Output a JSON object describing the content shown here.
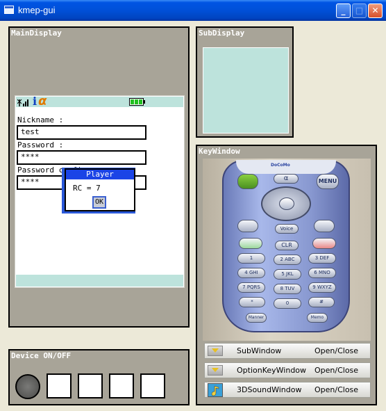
{
  "window": {
    "title": "kmep-gui",
    "minimize": "_",
    "maximize": "□",
    "close": "✕"
  },
  "main_display": {
    "title": "MainDisplay",
    "status_alpha": "α",
    "status_info": "i",
    "nickname_label": "Nickname :",
    "nickname_value": "test",
    "password_label": "Password :",
    "password_value": "****",
    "password_confirm_label": "Password confirm:",
    "password_confirm_value": "****",
    "dialog": {
      "title": "Player",
      "message": "RC = 7",
      "ok": "OK"
    }
  },
  "sub_display": {
    "title": "SubDisplay"
  },
  "key_window": {
    "title": "KeyWindow",
    "brand": "DoCoMo",
    "keys": {
      "alpha": "α",
      "menu": "MENU",
      "voice": "Voice",
      "clr": "CLR",
      "k1": "1",
      "k2": "2 ABC",
      "k3": "3 DEF",
      "k4": "4 GHI",
      "k5": "5 JKL",
      "k6": "6 MNO",
      "k7": "7 PQRS",
      "k8": "8 TUV",
      "k9": "9 WXYZ",
      "kstar": "*",
      "k0": "0",
      "khash": "#",
      "manner": "Manner",
      "memo": "Memo"
    },
    "rows": [
      {
        "name": "SubWindow",
        "action": "Open/Close",
        "icon": "toggle-icon"
      },
      {
        "name": "OptionKeyWindow",
        "action": "Open/Close",
        "icon": "toggle-icon"
      },
      {
        "name": "3DSoundWindow",
        "action": "Open/Close",
        "icon": "music-note-icon"
      }
    ]
  },
  "device": {
    "title": "Device ON/OFF"
  }
}
